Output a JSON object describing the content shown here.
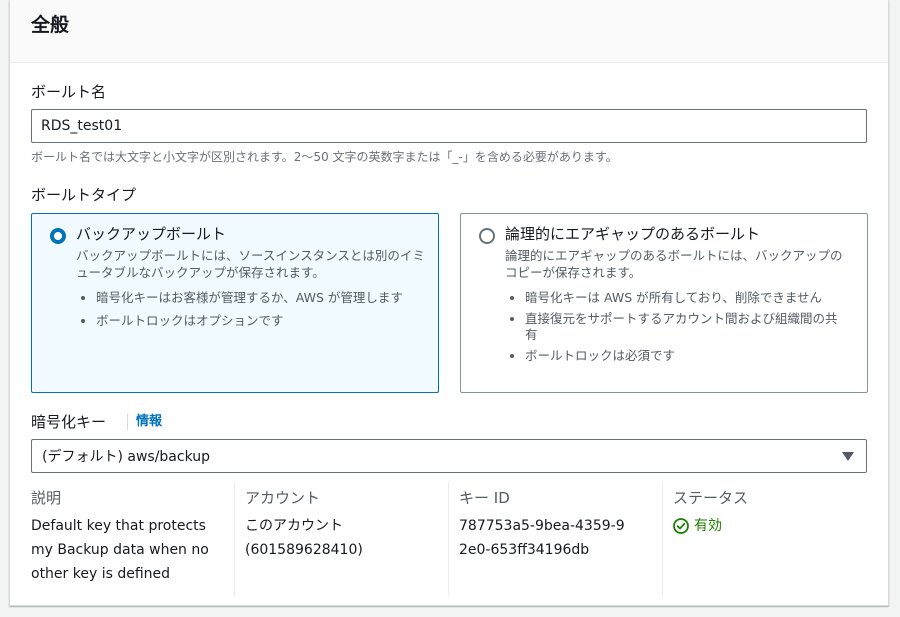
{
  "section": {
    "title": "全般"
  },
  "vault_name": {
    "label": "ボールト名",
    "value": "RDS_test01",
    "hint": "ボールト名では大文字と小文字が区別されます。2～50 文字の英数字または「_-」を含める必要があります。"
  },
  "vault_type": {
    "label": "ボールトタイプ",
    "options": [
      {
        "title": "バックアップボールト",
        "description": "バックアップボールトには、ソースインスタンスとは別のイミュータブルなバックアップが保存されます。",
        "bullets": [
          "暗号化キーはお客様が管理するか、AWS が管理します",
          "ボールトロックはオプションです"
        ],
        "selected": true
      },
      {
        "title": "論理的にエアギャップのあるボールト",
        "description": "論理的にエアギャップのあるボールトには、バックアップのコピーが保存されます。",
        "bullets": [
          "暗号化キーは AWS が所有しており、削除できません",
          "直接復元をサポートするアカウント間および組織間の共有",
          "ボールトロックは必須です"
        ],
        "selected": false
      }
    ]
  },
  "encryption": {
    "label": "暗号化キー",
    "info_link": "情報",
    "selected_value": "(デフォルト) aws/backup"
  },
  "key_details": {
    "description_label": "説明",
    "description_value": "Default key that protects my Backup data when no other key is defined",
    "account_label": "アカウント",
    "account_value_line1": "このアカウント",
    "account_value_line2": "(601589628410)",
    "key_id_label": "キー ID",
    "key_id_value": "787753a5-9bea-4359-92e0-653ff34196db",
    "status_label": "ステータス",
    "status_value": "有効"
  },
  "colors": {
    "accent": "#0073bb",
    "success": "#1d8102",
    "border": "#687078"
  }
}
